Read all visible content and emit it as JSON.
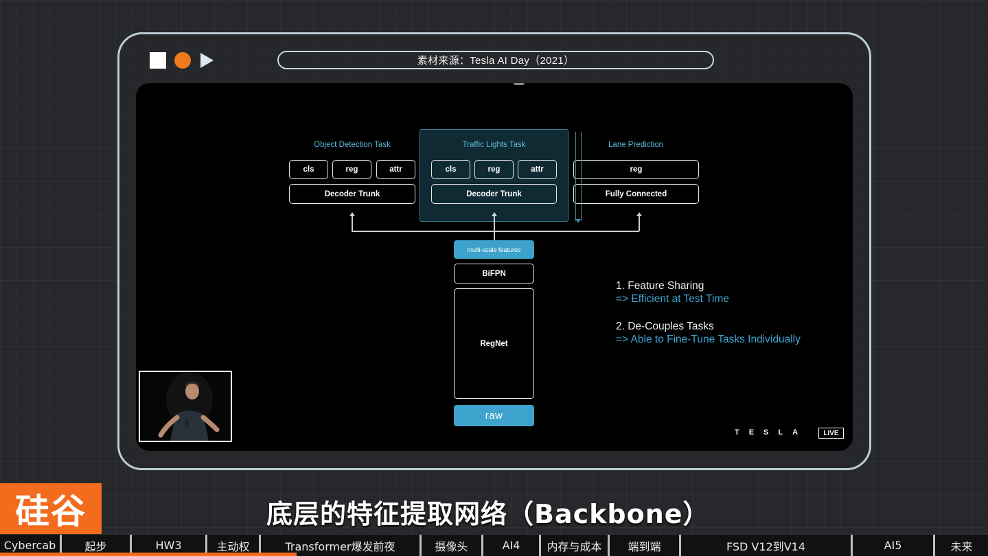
{
  "window": {
    "source_label": "素材来源：Tesla AI Day（2021）"
  },
  "slide": {
    "tasks": [
      {
        "label": "Object Detection Task",
        "heads": [
          "cls",
          "reg",
          "attr"
        ],
        "trunk": "Decoder Trunk"
      },
      {
        "label": "Traffic Lights Task",
        "heads": [
          "cls",
          "reg",
          "attr"
        ],
        "trunk": "Decoder Trunk"
      },
      {
        "label": "Lane Prediction",
        "heads": [
          "reg"
        ],
        "trunk": "Fully Connected"
      }
    ],
    "backbone": {
      "features": "multi-scale features",
      "neck": "BiFPN",
      "network": "RegNet",
      "input": "raw"
    },
    "notes": [
      {
        "head": "1. Feature Sharing",
        "sub": "=> Efficient at Test Time"
      },
      {
        "head": "2. De-Couples Tasks",
        "sub": "=> Able to Fine-Tune Tasks Individually"
      }
    ],
    "logo": "TESLA",
    "live": "LIVE"
  },
  "brand": {
    "text": "硅谷"
  },
  "subtitle": "底层的特征提取网络（Backbone）",
  "timeline": {
    "progress_fraction": 0.3,
    "chapters": [
      {
        "label": "Cybercab"
      },
      {
        "label": "起步"
      },
      {
        "label": "HW3"
      },
      {
        "label": "主动权"
      },
      {
        "label": "Transformer爆发前夜"
      },
      {
        "label": "摄像头"
      },
      {
        "label": "AI4"
      },
      {
        "label": "内存与成本"
      },
      {
        "label": "端到端"
      },
      {
        "label": "FSD  V12到V14"
      },
      {
        "label": "AI5"
      },
      {
        "label": "未来"
      }
    ]
  },
  "colors": {
    "accent_orange": "#f36b1d",
    "diagram_blue": "#3ea3cc",
    "frame": "#b9ccd8"
  }
}
